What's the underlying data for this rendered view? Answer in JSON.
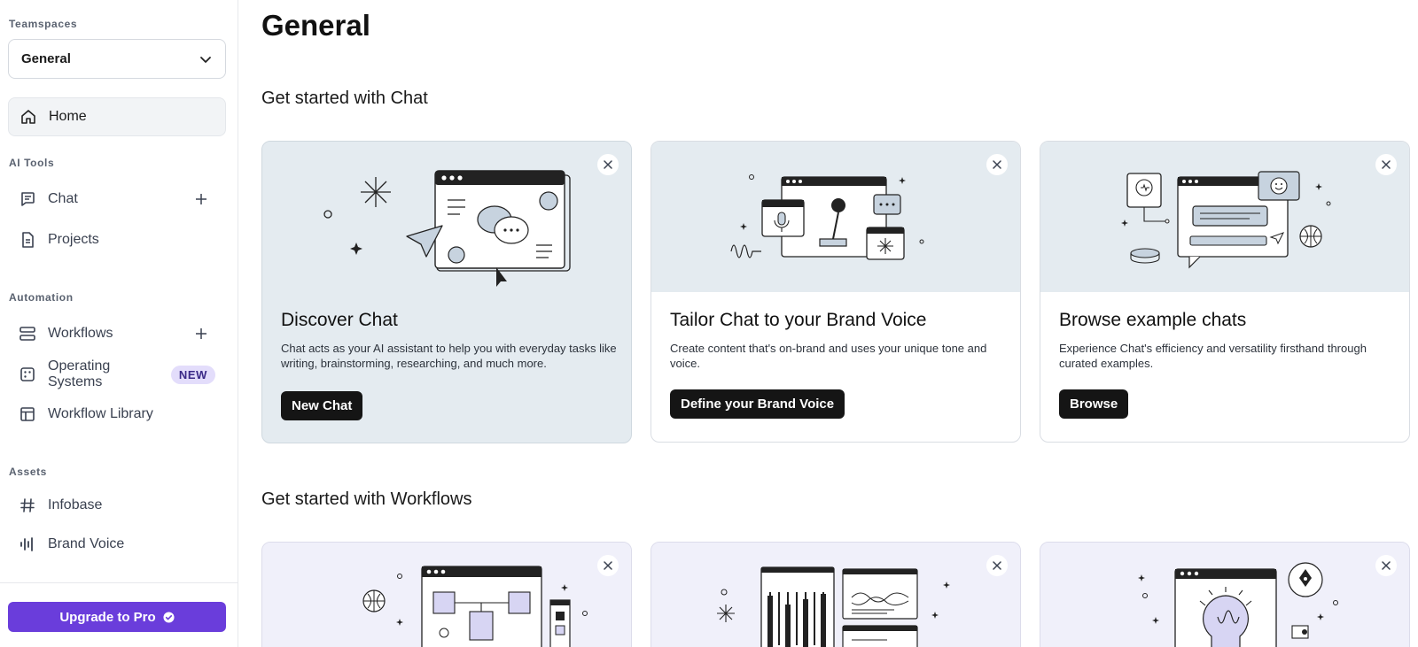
{
  "sidebar": {
    "teamspaces_label": "Teamspaces",
    "teamspace_selected": "General",
    "home_label": "Home",
    "ai_tools_label": "AI Tools",
    "chat_label": "Chat",
    "projects_label": "Projects",
    "automation_label": "Automation",
    "workflows_label": "Workflows",
    "operating_systems_label": "Operating Systems",
    "operating_systems_badge": "NEW",
    "workflow_library_label": "Workflow Library",
    "assets_label": "Assets",
    "infobase_label": "Infobase",
    "brand_voice_label": "Brand Voice",
    "upgrade_label": "Upgrade to Pro"
  },
  "main": {
    "page_title": "General",
    "chat_section_title": "Get started with Chat",
    "workflows_section_title": "Get started with Workflows",
    "chat_cards": [
      {
        "title": "Discover Chat",
        "description": "Chat acts as your AI assistant to help you with everyday tasks like writing, brainstorming, researching, and much more.",
        "button": "New Chat"
      },
      {
        "title": "Tailor Chat to your Brand Voice",
        "description": "Create content that's on-brand and uses your unique tone and voice.",
        "button": "Define your Brand Voice"
      },
      {
        "title": "Browse example chats",
        "description": "Experience Chat's efficiency and versatility firsthand through curated examples.",
        "button": "Browse"
      }
    ]
  },
  "colors": {
    "accent": "#6a3ddb",
    "badge_bg": "#e3ddfb",
    "card_illustration_bg": "#e4ebf0",
    "workflow_card_bg": "#f0f0fa",
    "button_dark": "#151515"
  },
  "icons": {
    "home": "home-icon",
    "chat": "chat-bubble-icon",
    "projects": "document-icon",
    "workflows": "workflow-icon",
    "operating_systems": "dice-grid-icon",
    "workflow_library": "layout-icon",
    "infobase": "hash-icon",
    "brand_voice": "soundbars-icon",
    "close": "close-icon",
    "add": "plus-icon",
    "dropdown": "chevron-down-icon",
    "verified": "verified-check-icon"
  }
}
